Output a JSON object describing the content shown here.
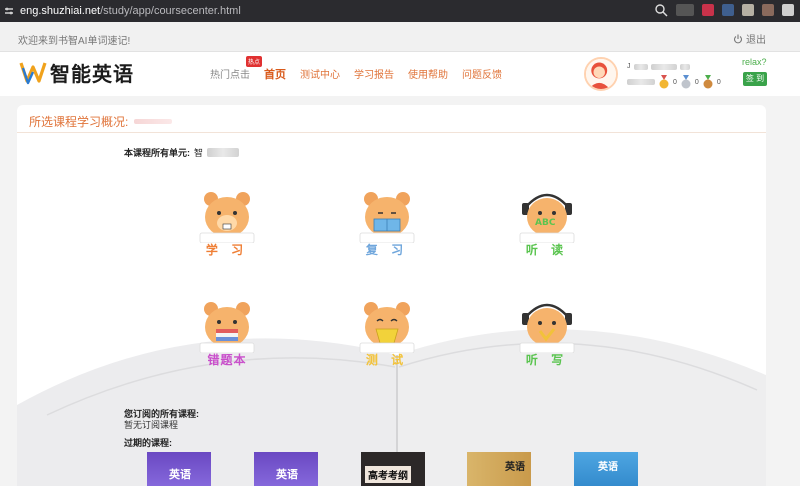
{
  "browser": {
    "url_host": "eng.shuzhiai.net",
    "url_path": "/study/app/coursecenter.html"
  },
  "topbar": {
    "welcome": "欢迎来到书智AI单词速记!",
    "logout": "退出"
  },
  "brand": {
    "name": "智能英语",
    "accent": "#e0743a"
  },
  "nav": {
    "items": [
      {
        "label": "热门点击",
        "badge": "热点"
      },
      {
        "label": "首页"
      },
      {
        "label": "测试中心"
      },
      {
        "label": "学习报告"
      },
      {
        "label": "使用帮助"
      },
      {
        "label": "问题反馈"
      }
    ]
  },
  "user": {
    "name_initial": "J",
    "medals": [
      {
        "icon": "gold-medal-icon",
        "count": "0"
      },
      {
        "icon": "silver-medal-icon",
        "count": "0"
      },
      {
        "icon": "bronze-medal-icon",
        "count": "0"
      }
    ],
    "relax": "relax?",
    "signin": "签 到"
  },
  "main": {
    "title": "所选课程学习概况:",
    "units_label": "本课程所有单元:",
    "units_value_visible": "智",
    "modules": [
      {
        "label": "学 习",
        "icon": "study-bear-icon"
      },
      {
        "label": "复 习",
        "icon": "review-bear-icon"
      },
      {
        "label": "听 读",
        "icon": "listen-read-bear-icon"
      },
      {
        "label": "错题本",
        "icon": "wrong-book-bear-icon"
      },
      {
        "label": "测 试",
        "icon": "test-bear-icon"
      },
      {
        "label": "听 写",
        "icon": "dictation-bear-icon"
      }
    ],
    "subscribed_title": "您订阅的所有课程:",
    "subscribed_empty": "暂无订阅课程",
    "expired_title": "过期的课程:",
    "expired_courses": [
      "英语",
      "英语",
      "高考考纲",
      "英语",
      "英语"
    ]
  }
}
